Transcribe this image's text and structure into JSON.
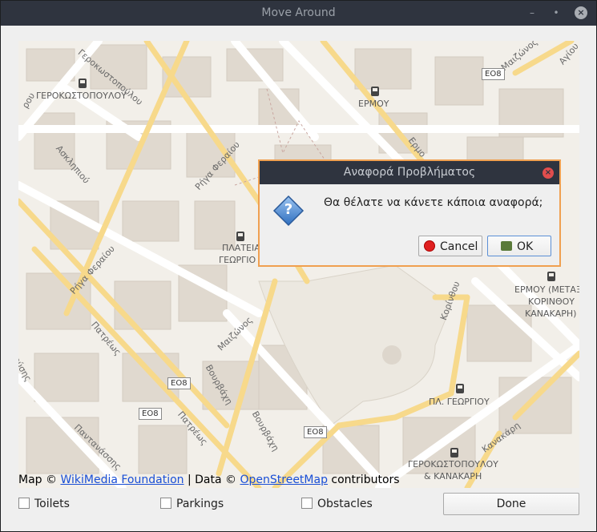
{
  "window": {
    "title": "Move Around",
    "min_glyph": "–",
    "max_glyph": "•",
    "close_glyph": "×"
  },
  "map": {
    "labels": {
      "stop1": "ΓΕΡΟΚΩΣΤΟΠΟΥΛΟΥ",
      "stop2": "ΕΡΜΟΥ",
      "stop3a": "ΠΛΑΤΕΙΑ",
      "stop3b": "ΓΕΩΡΓΙΟ",
      "stop4a": "ΕΡΜΟΥ (ΜΕΤΑΞ",
      "stop4b": "ΚΟΡΙΝΘΟΥ",
      "stop4c": "ΚΑΝΑΚΑΡΗ)",
      "stop5": "ΠΛ. ΓΕΩΡΓΙΟΥ",
      "stop6a": "ΓΕΡΟΚΩΣΤΟΠΟΥΛΟΥ",
      "stop6b": "& ΚΑΝΑΚΑΡΗ"
    },
    "streets": {
      "s1": "Ρήγα Φεραίου",
      "s2": "Ρήγα Φεραίου",
      "s3": "Ασκληπιού",
      "s4": "Πατρέως",
      "s5": "Πατρέως",
      "s6": "Μαιζώνος",
      "s7": "Βουρβάχη",
      "s8": "Βουρβάχη",
      "s9": "Κορίνθου",
      "s10": "Κανακάρη",
      "s11": "Παντανάσσης",
      "s12": "Γεροκωστοπούλου",
      "s13": "Μαιζώνος",
      "s14": "Αγίου",
      "s15": "Ερμο",
      "s16": "ούσης",
      "s17": "ρου"
    },
    "shields": {
      "a": "ΕΟ8",
      "b": "ΕΟ8",
      "c": "ΕΟ8",
      "d": "ΕΟ8"
    }
  },
  "attribution": {
    "prefix": "Map ©",
    "link1": "WikiMedia Foundation",
    "mid": "| Data ©",
    "link2": "OpenStreetMap",
    "suffix": "contributors"
  },
  "filters": {
    "toilets": "Toilets",
    "parkings": "Parkings",
    "obstacles": "Obstacles"
  },
  "done_label": "Done",
  "dialog": {
    "title": "Αναφορά Προβλήματος",
    "message": "Θα θέλατε να κάνετε κάποια αναφορά;",
    "cancel_label": "Cancel",
    "ok_label": "OK",
    "close_glyph": "×",
    "question_glyph": "?"
  },
  "colors": {
    "accent": "#f0a050",
    "titlebar": "#2f343f",
    "road": "#f7d98b",
    "block": "#e0d9cf"
  }
}
